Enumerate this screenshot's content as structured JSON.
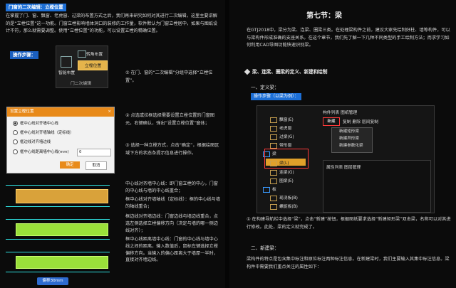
{
  "left": {
    "heading_tag": "门窗的二次编辑：立樘位置",
    "intro": "在掌握了门、窗、飘窗、老虎窗、过梁的布置方式之后，我们再来研究如何对其进行二次编辑，这里主要讲解的是“立樘位置”这一功能。门窗立樘影响墙体洞口的装修的工作量，软件默认为门窗立樘居中，如果与图纸设计不符，那么就需要调整。使用“立樘位置”的功能，可以设置立樘的精确位置。",
    "steps_tag": "操作步骤：",
    "ribbon": {
      "item1": "转角布置",
      "item2": "立樘位置",
      "left_label": "智能布置",
      "group_label": "门二次编辑"
    },
    "step1": "① 在门、窗的“二次编辑”分组中选择“立樘位置”。",
    "dialog": {
      "title": "设置立樘位置",
      "close": "×",
      "options": [
        "框中心线对齐墙中心线",
        "框中心线对齐墙轴线（定标线）",
        "框边线对齐墙边线",
        "框中心线距离墙中心线(mm)"
      ],
      "input_value": "0",
      "ok": "确定",
      "cancel": "取消"
    },
    "step2": "② 点选或拉框选择需要设置立樘位置的门窗图元，右键确认，弹出“设置立樘位置”窗体；",
    "step3": "③ 选择一种立樘方式，点击“确定”，根据绘图区域下方的状态条提示信息进行操作。",
    "p1": "中心线对齐墙中心线：即门窗立樘的中心，门窗的中心线与墙的中心线重合；",
    "p2": "框中心线对齐墙轴线（定标线）：框的中心线与墙的轴线重合；",
    "p3": "框边线对齐墙边线：门窗边线与墙边线重合，点选左侧选择立樘偏移方向（决定与墙的哪一侧边线对齐）；",
    "p4": "框中心线距离墙中心线：门窗的中心线与墙中心线之间的距离，输入数值后，鼠标左键选择立樘偏移方向。当输入的偏心距离大于墙厚一半时，直接对齐墙边线。",
    "bubble": "偏移30mm"
  },
  "right": {
    "title": "第七节：梁",
    "intro": "在GTJ2018中，梁分为梁、连梁、圈梁三类。在处理梁构件之前，建议大家先绘制好柱、墙等构件，可以与梁构件形成准确的支座关系。在这个章节，我们先了解一下几种不同类型的手工绘制方法；而求学习如何利用CAD导图功能快速识别梁。",
    "section_heading": "梁、连梁、圈梁的定义、新建和绘制",
    "sub1": "一、定义梁：",
    "steps_tag": "操作步骤（以梁为例）：",
    "tree": {
      "items": [
        "飘窗(E)",
        "老虎窗",
        "过梁(G)",
        "带形窗",
        "梁",
        "梁(L)",
        "连梁(G)",
        "圈梁(E)",
        "板",
        "现浇板(B)",
        "螺旋板(B)"
      ],
      "tabs": "构件列表   图纸管理",
      "new_btn": "新建",
      "toolbar": "复制  删除  层间复制",
      "menu": [
        "新建矩形梁",
        "新建异形梁",
        "新建参数化梁"
      ],
      "props_tabs": "属性列表   图层管理"
    },
    "step1": "① 在构建导航栏中选择“梁”，点击“新建”按钮，根据图纸要求选择“新建矩形梁”双击梁，名称可以对其进行修改。此处，梁的定义就完成了。",
    "sub2": "二、新建梁：",
    "p2": "梁构件的特点是包含集中标注和原位标注两种标注信息。在新建梁时，我们主要输入其集中标注信息。梁构件中需要我们重点关注的属性如下："
  }
}
